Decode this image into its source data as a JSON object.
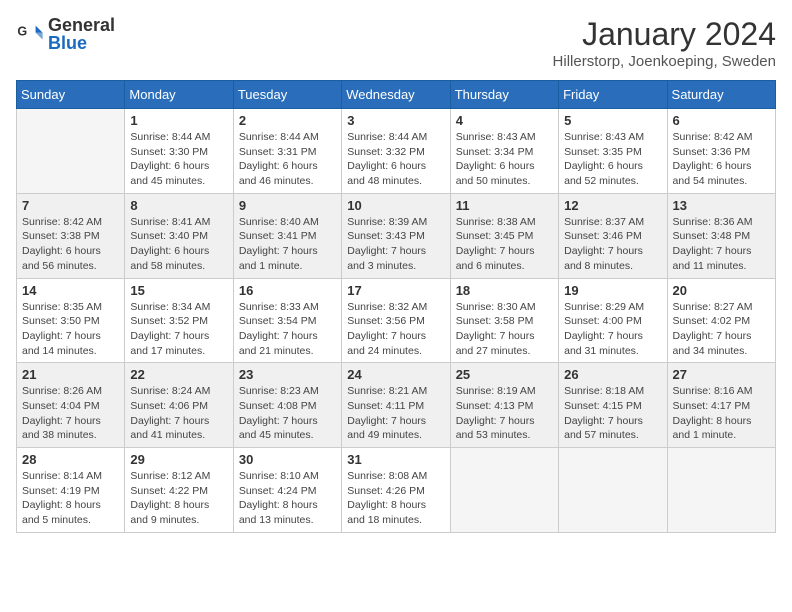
{
  "logo": {
    "text_general": "General",
    "text_blue": "Blue"
  },
  "title": {
    "month": "January 2024",
    "location": "Hillerstorp, Joenkoeping, Sweden"
  },
  "weekdays": [
    "Sunday",
    "Monday",
    "Tuesday",
    "Wednesday",
    "Thursday",
    "Friday",
    "Saturday"
  ],
  "weeks": [
    [
      {
        "day": "",
        "info": ""
      },
      {
        "day": "1",
        "info": "Sunrise: 8:44 AM\nSunset: 3:30 PM\nDaylight: 6 hours\nand 45 minutes."
      },
      {
        "day": "2",
        "info": "Sunrise: 8:44 AM\nSunset: 3:31 PM\nDaylight: 6 hours\nand 46 minutes."
      },
      {
        "day": "3",
        "info": "Sunrise: 8:44 AM\nSunset: 3:32 PM\nDaylight: 6 hours\nand 48 minutes."
      },
      {
        "day": "4",
        "info": "Sunrise: 8:43 AM\nSunset: 3:34 PM\nDaylight: 6 hours\nand 50 minutes."
      },
      {
        "day": "5",
        "info": "Sunrise: 8:43 AM\nSunset: 3:35 PM\nDaylight: 6 hours\nand 52 minutes."
      },
      {
        "day": "6",
        "info": "Sunrise: 8:42 AM\nSunset: 3:36 PM\nDaylight: 6 hours\nand 54 minutes."
      }
    ],
    [
      {
        "day": "7",
        "info": "Sunrise: 8:42 AM\nSunset: 3:38 PM\nDaylight: 6 hours\nand 56 minutes."
      },
      {
        "day": "8",
        "info": "Sunrise: 8:41 AM\nSunset: 3:40 PM\nDaylight: 6 hours\nand 58 minutes."
      },
      {
        "day": "9",
        "info": "Sunrise: 8:40 AM\nSunset: 3:41 PM\nDaylight: 7 hours\nand 1 minute."
      },
      {
        "day": "10",
        "info": "Sunrise: 8:39 AM\nSunset: 3:43 PM\nDaylight: 7 hours\nand 3 minutes."
      },
      {
        "day": "11",
        "info": "Sunrise: 8:38 AM\nSunset: 3:45 PM\nDaylight: 7 hours\nand 6 minutes."
      },
      {
        "day": "12",
        "info": "Sunrise: 8:37 AM\nSunset: 3:46 PM\nDaylight: 7 hours\nand 8 minutes."
      },
      {
        "day": "13",
        "info": "Sunrise: 8:36 AM\nSunset: 3:48 PM\nDaylight: 7 hours\nand 11 minutes."
      }
    ],
    [
      {
        "day": "14",
        "info": "Sunrise: 8:35 AM\nSunset: 3:50 PM\nDaylight: 7 hours\nand 14 minutes."
      },
      {
        "day": "15",
        "info": "Sunrise: 8:34 AM\nSunset: 3:52 PM\nDaylight: 7 hours\nand 17 minutes."
      },
      {
        "day": "16",
        "info": "Sunrise: 8:33 AM\nSunset: 3:54 PM\nDaylight: 7 hours\nand 21 minutes."
      },
      {
        "day": "17",
        "info": "Sunrise: 8:32 AM\nSunset: 3:56 PM\nDaylight: 7 hours\nand 24 minutes."
      },
      {
        "day": "18",
        "info": "Sunrise: 8:30 AM\nSunset: 3:58 PM\nDaylight: 7 hours\nand 27 minutes."
      },
      {
        "day": "19",
        "info": "Sunrise: 8:29 AM\nSunset: 4:00 PM\nDaylight: 7 hours\nand 31 minutes."
      },
      {
        "day": "20",
        "info": "Sunrise: 8:27 AM\nSunset: 4:02 PM\nDaylight: 7 hours\nand 34 minutes."
      }
    ],
    [
      {
        "day": "21",
        "info": "Sunrise: 8:26 AM\nSunset: 4:04 PM\nDaylight: 7 hours\nand 38 minutes."
      },
      {
        "day": "22",
        "info": "Sunrise: 8:24 AM\nSunset: 4:06 PM\nDaylight: 7 hours\nand 41 minutes."
      },
      {
        "day": "23",
        "info": "Sunrise: 8:23 AM\nSunset: 4:08 PM\nDaylight: 7 hours\nand 45 minutes."
      },
      {
        "day": "24",
        "info": "Sunrise: 8:21 AM\nSunset: 4:11 PM\nDaylight: 7 hours\nand 49 minutes."
      },
      {
        "day": "25",
        "info": "Sunrise: 8:19 AM\nSunset: 4:13 PM\nDaylight: 7 hours\nand 53 minutes."
      },
      {
        "day": "26",
        "info": "Sunrise: 8:18 AM\nSunset: 4:15 PM\nDaylight: 7 hours\nand 57 minutes."
      },
      {
        "day": "27",
        "info": "Sunrise: 8:16 AM\nSunset: 4:17 PM\nDaylight: 8 hours\nand 1 minute."
      }
    ],
    [
      {
        "day": "28",
        "info": "Sunrise: 8:14 AM\nSunset: 4:19 PM\nDaylight: 8 hours\nand 5 minutes."
      },
      {
        "day": "29",
        "info": "Sunrise: 8:12 AM\nSunset: 4:22 PM\nDaylight: 8 hours\nand 9 minutes."
      },
      {
        "day": "30",
        "info": "Sunrise: 8:10 AM\nSunset: 4:24 PM\nDaylight: 8 hours\nand 13 minutes."
      },
      {
        "day": "31",
        "info": "Sunrise: 8:08 AM\nSunset: 4:26 PM\nDaylight: 8 hours\nand 18 minutes."
      },
      {
        "day": "",
        "info": ""
      },
      {
        "day": "",
        "info": ""
      },
      {
        "day": "",
        "info": ""
      }
    ]
  ]
}
